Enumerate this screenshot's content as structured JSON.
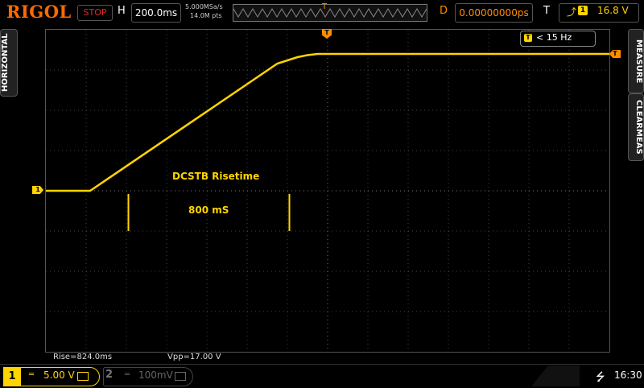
{
  "brand": "RIGOL",
  "status": {
    "run_state": "STOP"
  },
  "horizontal": {
    "label": "H",
    "timebase": "200.0ms",
    "sample_rate": "5.000MSa/s",
    "memory_depth": "14.0M pts",
    "trigger_marker": "T"
  },
  "delay": {
    "label": "D",
    "value": "0.00000000ps"
  },
  "trigger": {
    "label": "T",
    "edge_icon": "rising-edge-icon",
    "source": "1",
    "level": "16.8 V"
  },
  "side_tabs": {
    "horizontal": "HORIZONTAL",
    "measure": "MEASURE",
    "clear_meas": "CLEARMEAS"
  },
  "freq_counter": {
    "icon_label": "T",
    "value": "< 15 Hz"
  },
  "markers": {
    "ch1": "1",
    "trigger_pos": "T",
    "trigger_level": "T"
  },
  "annotations": {
    "title": "DCSTB Risetime",
    "duration": "800 mS"
  },
  "measurements": {
    "rise": "Rise=824.0ms",
    "vpp": "Vpp=17.00 V"
  },
  "channels": [
    {
      "number": "1",
      "coupling": "═",
      "scale": "5.00 V",
      "active": true,
      "color": "#ffd400"
    },
    {
      "number": "2",
      "coupling": "═",
      "scale": "100mV",
      "active": false,
      "color": "#666666"
    }
  ],
  "system": {
    "usb_icon": "usb-icon",
    "usb_glyph": "⭍",
    "time": "16:30"
  },
  "colors": {
    "ch1": "#ffd400",
    "trigger": "#ff8c00",
    "stop": "#e0281f",
    "brand": "#ff6a00",
    "grid": "#555555"
  },
  "chart_data": {
    "type": "line",
    "x_unit": "s",
    "y_unit": "V",
    "x_per_div": 0.2,
    "y_per_div": 5.0,
    "x_divisions": 14,
    "y_divisions": 8,
    "xlim": [
      -1.4,
      1.4
    ],
    "ylim": [
      -20,
      20
    ],
    "grid": true,
    "series": [
      {
        "color": "#ffd400",
        "x": [
          -1.4,
          -1.18,
          -0.25,
          -0.15,
          -0.1,
          -0.05,
          0.0,
          1.4
        ],
        "y": [
          0.0,
          0.0,
          15.8,
          16.6,
          16.85,
          17.0,
          17.0,
          17.0
        ]
      }
    ],
    "markers": [
      {
        "x": -0.99,
        "y_top": 0.0,
        "y_bottom": -5.0
      },
      {
        "x": -0.19,
        "y_top": 0.0,
        "y_bottom": -5.0
      }
    ]
  }
}
